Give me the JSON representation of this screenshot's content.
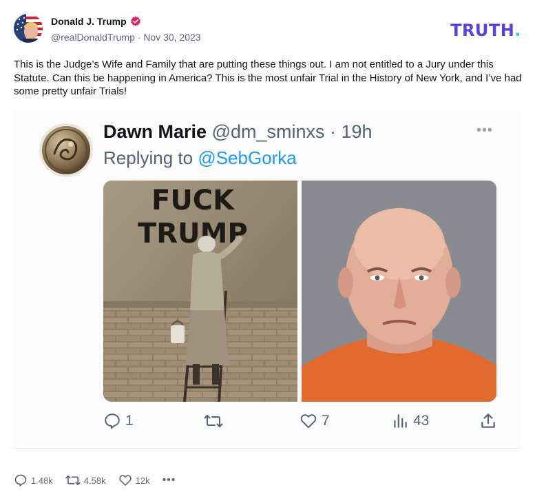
{
  "author": {
    "display_name": "Donald J. Trump",
    "handle": "@realDonaldTrump",
    "separator": "·",
    "date": "Nov 30, 2023",
    "verified_icon": "verified-badge-icon",
    "verified_color": "#e0245e"
  },
  "brand": {
    "logo_text": "TRUTH",
    "logo_dot": ".",
    "logo_color": "#5a43d6",
    "logo_dot_color": "#2fd4c6"
  },
  "post": {
    "text": "This is the Judge’s Wife and Family that are putting these things out. I am not entitled to a Jury under this Statute. Can this be happening in America? This is the most unfair Trial in the History of New York, and I’ve had some pretty unfair Trials!"
  },
  "embedded_tweet": {
    "name": "Dawn Marie",
    "handle": "@dm_sminxs",
    "time": "· 19h",
    "replying_prefix": "Replying to",
    "replying_to": "@SebGorka",
    "more_icon": "more-dots-icon",
    "left_image": {
      "graffiti_text_line1": "FUCK",
      "graffiti_text_line2": "TRUMP"
    },
    "actions": {
      "replies": "1",
      "retweets": "",
      "likes": "7",
      "views": "43"
    },
    "accent_color": "#1d9bf0"
  },
  "post_actions": {
    "replies": "1.48k",
    "retruths": "4.58k",
    "likes": "12k",
    "more": "•••"
  }
}
